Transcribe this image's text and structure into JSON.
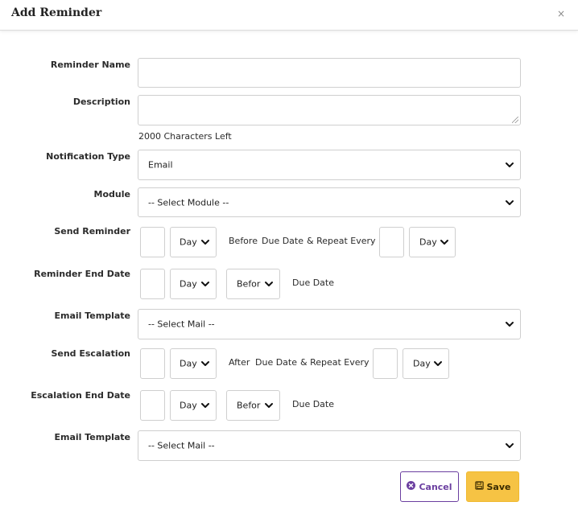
{
  "dialog": {
    "title": "Add Reminder",
    "close_glyph": "×"
  },
  "fields": {
    "reminder_name": {
      "label": "Reminder Name",
      "value": ""
    },
    "description": {
      "label": "Description",
      "value": "",
      "chars_left": "2000 Characters Left"
    },
    "notification_type": {
      "label": "Notification Type",
      "value": "Email"
    },
    "module": {
      "label": "Module",
      "value": "-- Select Module --"
    },
    "send_reminder": {
      "label": "Send Reminder",
      "unit": "Day",
      "text_before": "Before",
      "text_due": "Due Date",
      "text_repeat": "& Repeat Every",
      "repeat_unit": "Day"
    },
    "reminder_end_date": {
      "label": "Reminder End Date",
      "unit": "Day",
      "relation": "Befor",
      "text_due": "Due Date"
    },
    "email_template_1": {
      "label": "Email Template",
      "value": "-- Select Mail --"
    },
    "send_escalation": {
      "label": "Send Escalation",
      "unit": "Day",
      "text_after": "After",
      "text_due": "Due Date",
      "text_repeat": "& Repeat Every",
      "repeat_unit": "Day"
    },
    "escalation_end_date": {
      "label": "Escalation End Date",
      "unit": "Day",
      "relation": "Befor",
      "text_due": "Due Date"
    },
    "email_template_2": {
      "label": "Email Template",
      "value": "-- Select Mail --"
    }
  },
  "actions": {
    "cancel_label": "Cancel",
    "save_label": "Save"
  },
  "colors": {
    "cancel_accent": "#6b3fa0",
    "save_bg": "#f6c344"
  },
  "icons": {
    "close": "close-icon",
    "cancel": "circle-x-icon",
    "save": "floppy-disk-icon",
    "select": "chevron-down-icon"
  }
}
